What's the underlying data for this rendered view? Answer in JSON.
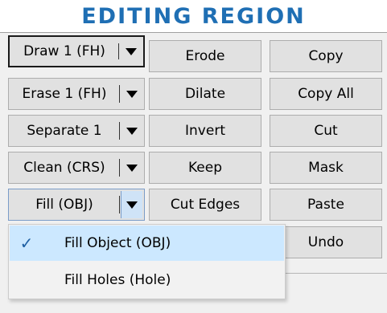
{
  "header": {
    "title": "EDITING REGION"
  },
  "col1": [
    {
      "id": "draw",
      "label": "Draw 1 (FH)"
    },
    {
      "id": "erase",
      "label": "Erase 1 (FH)"
    },
    {
      "id": "separate",
      "label": "Separate 1"
    },
    {
      "id": "clean",
      "label": "Clean (CRS)"
    },
    {
      "id": "fill",
      "label": "Fill (OBJ)"
    }
  ],
  "col2": [
    {
      "id": "erode",
      "label": "Erode"
    },
    {
      "id": "dilate",
      "label": "Dilate"
    },
    {
      "id": "invert",
      "label": "Invert"
    },
    {
      "id": "keep",
      "label": "Keep"
    },
    {
      "id": "cut-edges",
      "label": "Cut Edges"
    }
  ],
  "col3": [
    {
      "id": "copy",
      "label": "Copy"
    },
    {
      "id": "copy-all",
      "label": "Copy All"
    },
    {
      "id": "cut",
      "label": "Cut"
    },
    {
      "id": "mask",
      "label": "Mask"
    },
    {
      "id": "paste",
      "label": "Paste"
    },
    {
      "id": "undo",
      "label": "Undo"
    }
  ],
  "dropdown": {
    "options": [
      {
        "label": "Fill Object (OBJ)",
        "selected": true,
        "check": "✓"
      },
      {
        "label": "Fill Holes (Hole)",
        "selected": false,
        "check": ""
      }
    ]
  },
  "colors": {
    "header": "#1f6fb4",
    "button_face": "#e1e1e1",
    "button_border": "#adadad",
    "selection": "#cce8ff"
  }
}
